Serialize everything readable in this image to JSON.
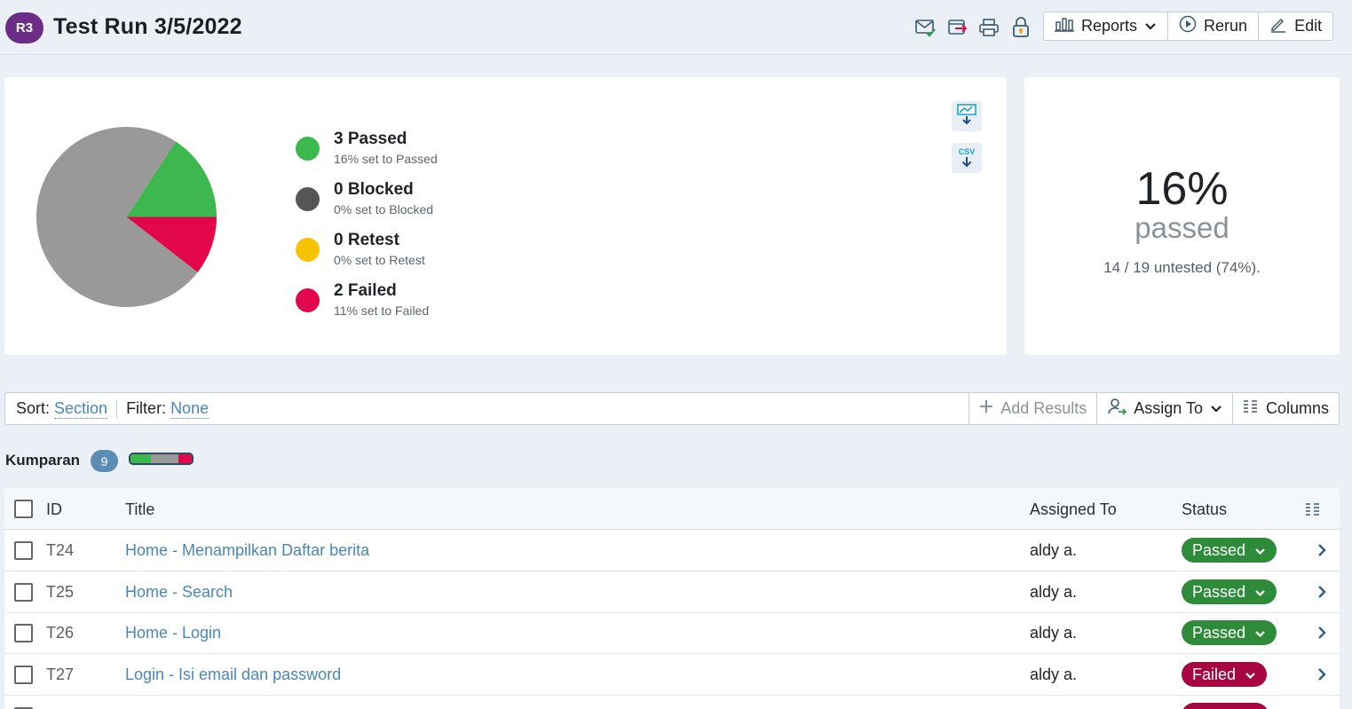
{
  "header": {
    "run_badge": "R3",
    "title": "Test Run 3/5/2022",
    "actions": {
      "reports": "Reports",
      "rerun": "Rerun",
      "edit": "Edit"
    }
  },
  "summary": {
    "legend": [
      {
        "title": "3 Passed",
        "sub": "16% set to Passed",
        "color": "#3cb84f"
      },
      {
        "title": "0 Blocked",
        "sub": "0% set to Blocked",
        "color": "#555555"
      },
      {
        "title": "0 Retest",
        "sub": "0% set to Retest",
        "color": "#f7c200"
      },
      {
        "title": "2 Failed",
        "sub": "11% set to Failed",
        "color": "#e2064a"
      }
    ],
    "export": {
      "csv": "CSV"
    },
    "percent": "16%",
    "percent_label": "passed",
    "untested": "14 / 19 untested (74%)."
  },
  "chart_data": {
    "type": "pie",
    "categories": [
      "Passed",
      "Failed",
      "Untested"
    ],
    "values": [
      3,
      2,
      14
    ],
    "colors": [
      "#3cb84f",
      "#e2064a",
      "#999999"
    ]
  },
  "toolbar": {
    "sort_label": "Sort:",
    "sort_value": "Section",
    "filter_label": "Filter:",
    "filter_value": "None",
    "add_results": "Add Results",
    "assign_to": "Assign To",
    "columns": "Columns"
  },
  "section": {
    "name": "Kumparan",
    "count": "9",
    "progress": {
      "passed": 0.33,
      "untested": 0.45,
      "failed": 0.22
    }
  },
  "table": {
    "headers": {
      "id": "ID",
      "title": "Title",
      "assigned": "Assigned To",
      "status": "Status"
    },
    "rows": [
      {
        "id": "T24",
        "title": "Home - Menampilkan Daftar berita",
        "assigned": "aldy a.",
        "status": "Passed"
      },
      {
        "id": "T25",
        "title": "Home - Search",
        "assigned": "aldy a.",
        "status": "Passed"
      },
      {
        "id": "T26",
        "title": "Home - Login",
        "assigned": "aldy a.",
        "status": "Passed"
      },
      {
        "id": "T27",
        "title": "Login - Isi email dan password",
        "assigned": "aldy a.",
        "status": "Failed"
      }
    ]
  },
  "colors": {
    "passed": "#2e8b3a",
    "failed": "#a8063f",
    "link": "#4a87b6"
  }
}
